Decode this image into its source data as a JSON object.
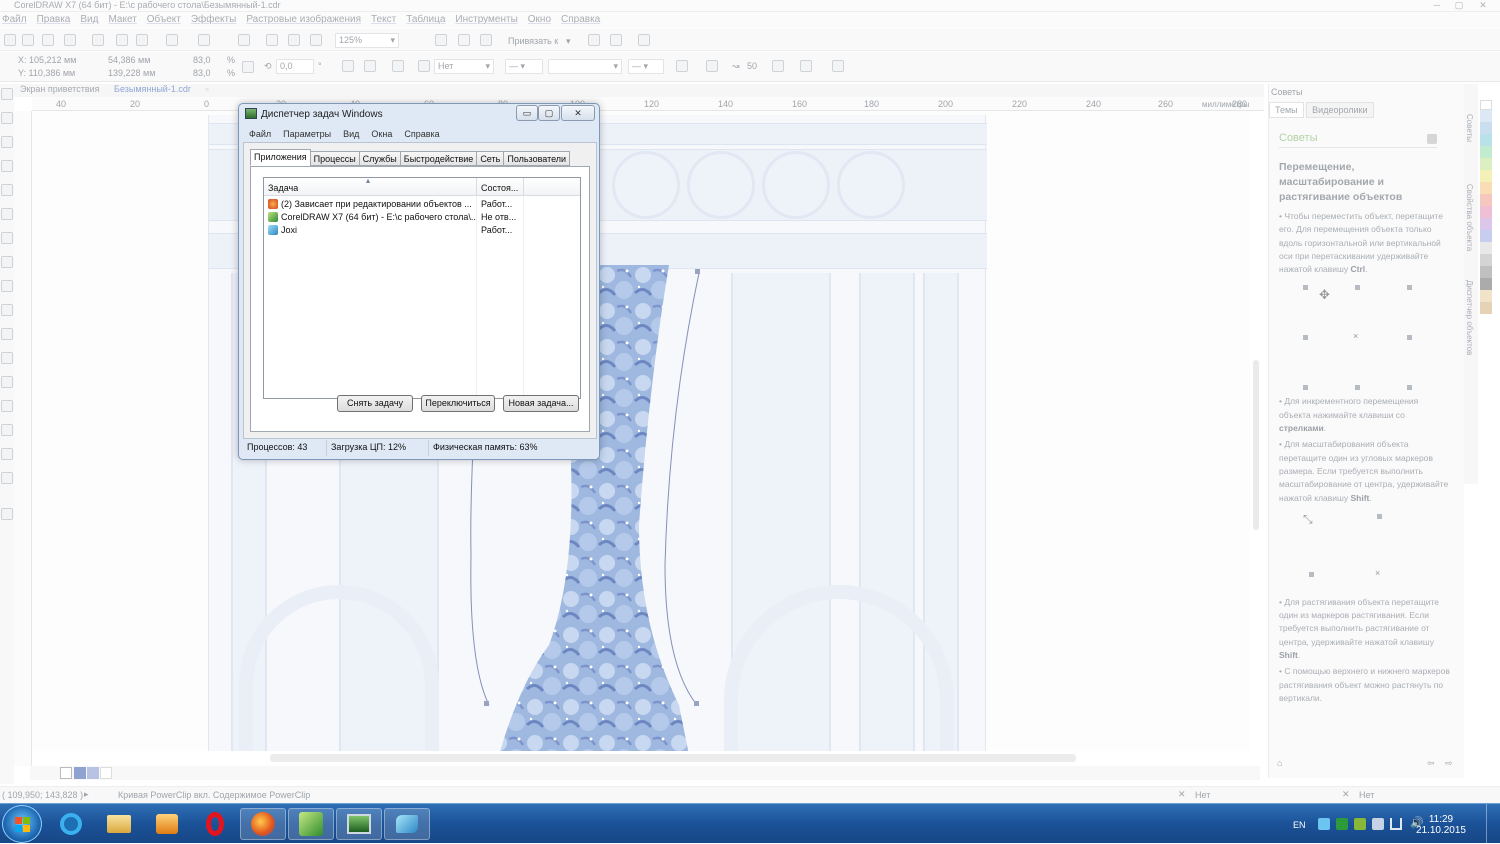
{
  "window": {
    "title": "CorelDRAW X7 (64 бит) - E:\\с рабочего стола\\Безымянный-1.cdr",
    "menu": [
      "Файл",
      "Правка",
      "Вид",
      "Макет",
      "Объект",
      "Эффекты",
      "Растровые изображения",
      "Текст",
      "Таблица",
      "Инструменты",
      "Окно",
      "Справка"
    ]
  },
  "toolbar": {
    "zoom": "125%",
    "snap_label": "Привязать к"
  },
  "propbar": {
    "x": "X: 105,212 мм",
    "y": "Y: 110,386 мм",
    "w": "54,386 мм",
    "h": "139,228 мм",
    "sx": "83,0",
    "sy": "83,0",
    "pct": "%",
    "angle": "0,0",
    "deg": "°",
    "outline_none": "Нет",
    "smooth": "50"
  },
  "doc_tabs": [
    "Экран приветствия",
    "Безымянный-1.cdr"
  ],
  "ruler": {
    "ticks": [
      "40",
      "20",
      "0",
      "20",
      "40",
      "60",
      "80",
      "100",
      "120",
      "140",
      "160",
      "180",
      "200",
      "220",
      "240",
      "260",
      "280"
    ],
    "unit": "миллиметры"
  },
  "statusbar": {
    "coords": "( 109,950; 143,828 )",
    "object": "Кривая PowerClip вкл. Содержимое PowerClip",
    "fill_none": "Нет",
    "outline_none": "Нет"
  },
  "right_panel": {
    "header": "Советы",
    "tabs": [
      "Темы",
      "Видеоролики"
    ],
    "section": "Советы",
    "heading": "Перемещение, масштабирование и растягивание объектов",
    "p1": "Чтобы переместить объект, перетащите его. Для перемещения объекта только вдоль горизонтальной или вертикальной оси при перетаскивании удерживайте нажатой клавишу ",
    "p1_key": "Ctrl",
    "p2": "Для инкрементного перемещения объекта нажимайте клавиши со ",
    "p2_key": "стрелками",
    "p3": "Для масштабирования объекта перетащите один из угловых маркеров размера. Если требуется выполнить масштабирование от центра, удерживайте нажатой клавишу ",
    "p3_key": "Shift",
    "p4": "Для растягивания объекта перетащите один из маркеров растягивания. Если требуется выполнить растягивание от центра, удерживайте нажатой клавишу ",
    "p4_key": "Shift",
    "p5": "С помощью верхнего и нижнего маркеров растягивания объект можно растянуть по вертикали.",
    "vtabs": [
      "Советы",
      "Свойства объекта",
      "Диспетчер объектов"
    ]
  },
  "task_manager": {
    "title": "Диспетчер задач Windows",
    "menu": [
      "Файл",
      "Параметры",
      "Вид",
      "Окна",
      "Справка"
    ],
    "tabs": [
      "Приложения",
      "Процессы",
      "Службы",
      "Быстродействие",
      "Сеть",
      "Пользователи"
    ],
    "columns": [
      "Задача",
      "Состоя..."
    ],
    "rows": [
      {
        "task": "(2) Зависает при редактировании объектов ...",
        "status": "Работ...",
        "icon_color": "#e8632a"
      },
      {
        "task": "CorelDRAW X7 (64 бит) - E:\\с рабочего стола\\...",
        "status": "Не отв...",
        "icon_color": "#3a9a3a"
      },
      {
        "task": "Joxi",
        "status": "Работ...",
        "icon_color": "#4aa3d8"
      }
    ],
    "buttons": [
      "Снять задачу",
      "Переключиться",
      "Новая задача..."
    ],
    "status": [
      "Процессов: 43",
      "Загрузка ЦП: 12%",
      "Физическая память: 63%"
    ],
    "controls": [
      "▭",
      "▢",
      "✕"
    ]
  },
  "taskbar": {
    "lang": "EN",
    "time": "11:29",
    "date": "21.10.2015"
  },
  "colors": {
    "taskbar": "#1b5298",
    "pattern_blue": "#9fb8e0",
    "pattern_dark": "#6d87c2"
  }
}
